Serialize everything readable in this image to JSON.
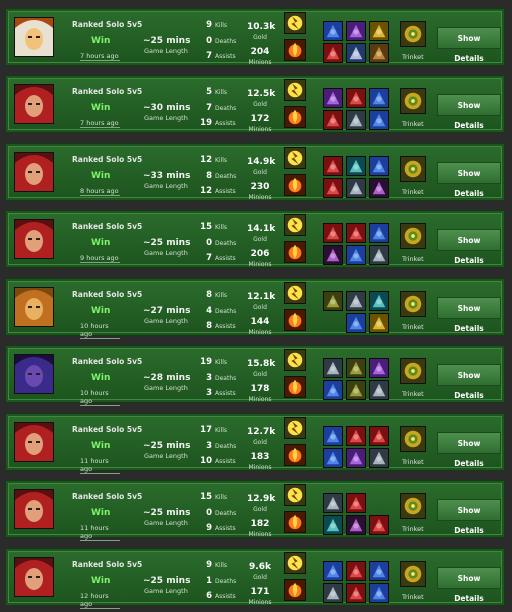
{
  "labels": {
    "kills": "Kills",
    "deaths": "Deaths",
    "assists": "Assists",
    "gold": "Gold",
    "minions": "Minions",
    "game_length": "Game Length",
    "trinket": "Trinket",
    "show_details": "Show Details"
  },
  "colors": {
    "row_bg": "#2a6b2b",
    "win_text": "#7ef36a",
    "button": "#3f7f3f"
  },
  "matches": [
    {
      "mode": "Ranked Solo 5v5",
      "result": "Win",
      "ago": "7 hours ago",
      "length": "~25 mins",
      "kills": "9",
      "deaths": "0",
      "assists": "7",
      "gold": "10.3k",
      "minions": "204",
      "champion": "bearded-champion",
      "items": [
        "blue-item",
        "purple-item",
        "yellow-item",
        "red-item",
        "wing-item",
        "book-item"
      ]
    },
    {
      "mode": "Ranked Solo 5v5",
      "result": "Win",
      "ago": "7 hours ago",
      "length": "~30 mins",
      "kills": "5",
      "deaths": "7",
      "assists": "19",
      "gold": "12.5k",
      "minions": "172",
      "champion": "red-haired-champion",
      "items": [
        "purple-item",
        "red-item",
        "blue-item",
        "red-item",
        "steel-item",
        "blue-item"
      ]
    },
    {
      "mode": "Ranked Solo 5v5",
      "result": "Win",
      "ago": "8 hours ago",
      "length": "~33 mins",
      "kills": "12",
      "deaths": "8",
      "assists": "12",
      "gold": "14.9k",
      "minions": "230",
      "champion": "red-haired-champion",
      "items": [
        "red-item",
        "teal-item",
        "blue-item",
        "red-item",
        "steel-item",
        "sword-item"
      ]
    },
    {
      "mode": "Ranked Solo 5v5",
      "result": "Win",
      "ago": "9 hours ago",
      "length": "~25 mins",
      "kills": "15",
      "deaths": "0",
      "assists": "7",
      "gold": "14.1k",
      "minions": "206",
      "champion": "red-haired-champion",
      "items": [
        "red-item",
        "red-item",
        "blue-item",
        "sword-item",
        "blue-item",
        "steel-item"
      ]
    },
    {
      "mode": "Ranked Solo 5v5",
      "result": "Win",
      "ago": "10 hours ago",
      "length": "~27 mins",
      "kills": "8",
      "deaths": "4",
      "assists": "8",
      "gold": "12.1k",
      "minions": "144",
      "champion": "golden-champion",
      "items": [
        "olive-item",
        "steel-item",
        "teal-item",
        "",
        "blue-item",
        "yellow-item"
      ]
    },
    {
      "mode": "Ranked Solo 5v5",
      "result": "Win",
      "ago": "10 hours ago",
      "length": "~28 mins",
      "kills": "19",
      "deaths": "3",
      "assists": "3",
      "gold": "15.8k",
      "minions": "178",
      "champion": "violet-champion",
      "items": [
        "steel-item",
        "olive-item",
        "purple-item",
        "blue-item",
        "olive-item",
        "steel-item"
      ]
    },
    {
      "mode": "Ranked Solo 5v5",
      "result": "Win",
      "ago": "11 hours ago",
      "length": "~25 mins",
      "kills": "17",
      "deaths": "3",
      "assists": "10",
      "gold": "12.7k",
      "minions": "183",
      "champion": "red-haired-champion",
      "items": [
        "blue-item",
        "red-item",
        "red-item",
        "blue-item",
        "purple-item",
        "steel-item"
      ]
    },
    {
      "mode": "Ranked Solo 5v5",
      "result": "Win",
      "ago": "11 hours ago",
      "length": "~25 mins",
      "kills": "15",
      "deaths": "0",
      "assists": "9",
      "gold": "12.9k",
      "minions": "182",
      "champion": "red-haired-champion",
      "items": [
        "steel-item",
        "red-item",
        "",
        "teal-item",
        "sword-item",
        "red-item"
      ]
    },
    {
      "mode": "Ranked Solo 5v5",
      "result": "Win",
      "ago": "12 hours ago",
      "length": "~25 mins",
      "kills": "9",
      "deaths": "1",
      "assists": "6",
      "gold": "9.6k",
      "minions": "171",
      "champion": "red-haired-champion",
      "items": [
        "blue-item",
        "red-item",
        "blue-item",
        "steel-item",
        "red-item",
        "blue-item"
      ]
    }
  ]
}
